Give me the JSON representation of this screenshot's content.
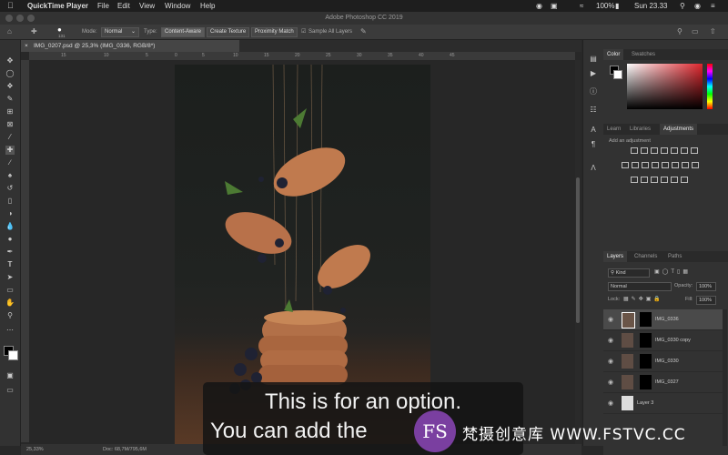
{
  "menubar": {
    "app": "QuickTime Player",
    "items": [
      "File",
      "Edit",
      "View",
      "Window",
      "Help"
    ],
    "battery": "100%",
    "clock": "Sun 23.33"
  },
  "window": {
    "title": "Adobe Photoshop CC 2019"
  },
  "options": {
    "brush_size": "131",
    "mode_label": "Mode:",
    "mode_value": "Normal",
    "type_label": "Type:",
    "content_aware": "Content-Aware",
    "create_texture": "Create Texture",
    "proximity_match": "Proximity Match",
    "sample_all_layers": "Sample All Layers"
  },
  "document": {
    "tab": "IMG_0207.psd @ 25,3% (IMG_0336, RGB/8*)",
    "ruler_marks": [
      "15",
      "10",
      "5",
      "0",
      "5",
      "10",
      "15",
      "20",
      "25",
      "30",
      "35",
      "40",
      "45"
    ]
  },
  "status": {
    "zoom": "25,33%",
    "doc": "Doc: 68,7M/795,6M"
  },
  "color_panel": {
    "tabs": [
      "Color",
      "Swatches"
    ],
    "active": "Color"
  },
  "adjust_panel": {
    "tabs": [
      "Learn",
      "Libraries",
      "Adjustments"
    ],
    "active": "Adjustments",
    "hint": "Add an adjustment"
  },
  "layers_panel": {
    "tabs": [
      "Layers",
      "Channels",
      "Paths"
    ],
    "active": "Layers",
    "filter": "Kind",
    "blend": "Normal",
    "opacity_label": "Opacity:",
    "opacity_value": "100%",
    "lock_label": "Lock:",
    "fill_label": "Fill:",
    "fill_value": "100%",
    "layers": [
      {
        "name": "IMG_0336",
        "selected": true
      },
      {
        "name": "IMG_0330 copy",
        "selected": false
      },
      {
        "name": "IMG_0330",
        "selected": false
      },
      {
        "name": "IMG_0327",
        "selected": false
      },
      {
        "name": "Layer 3",
        "selected": false
      }
    ]
  },
  "subtitles": {
    "line1": "This is for an option.",
    "line2": "You can add the"
  },
  "watermark": {
    "logo": "FS",
    "text": "梵摄创意库 WWW.FSTVC.CC"
  },
  "colors": {
    "accent": "#7a3fa0",
    "panel": "#323232",
    "pancake": "#c07a4e"
  }
}
